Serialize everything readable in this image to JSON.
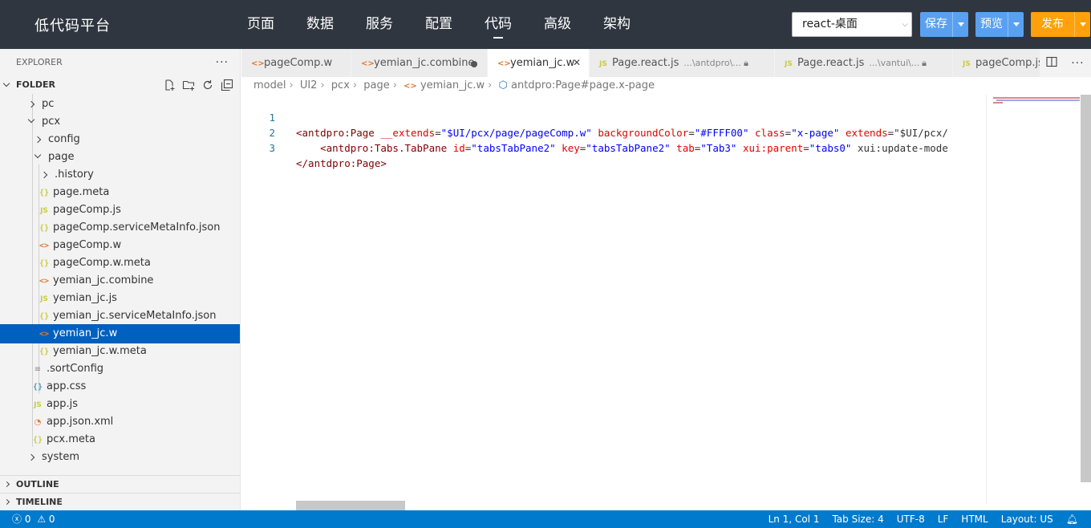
{
  "app": {
    "logo": "低代码平台"
  },
  "nav": [
    {
      "label": "页面"
    },
    {
      "label": "数据"
    },
    {
      "label": "服务"
    },
    {
      "label": "配置"
    },
    {
      "label": "代码"
    },
    {
      "label": "高级"
    },
    {
      "label": "架构"
    }
  ],
  "nav_active": "代码",
  "toolbar": {
    "project": "react-桌面",
    "save_label": "保存",
    "preview_label": "预览",
    "publish_label": "发布",
    "accent_blue": "#5aa0f0",
    "accent_orange": "#ffa10a"
  },
  "sidebar": {
    "explorer_title": "EXPLORER",
    "folder_title": "FOLDER",
    "tree": [
      {
        "label": "pc",
        "icon": "chevron-right-icon"
      },
      {
        "label": "pcx",
        "icon": "chevron-down-icon"
      },
      {
        "label": "config",
        "icon": "chevron-right-icon"
      },
      {
        "label": "page",
        "icon": "chevron-down-icon"
      },
      {
        "label": ".history",
        "icon": "chevron-right-icon"
      },
      {
        "label": "page.meta",
        "icon": "json-file-icon"
      },
      {
        "label": "pageComp.js",
        "icon": "js-file-icon"
      },
      {
        "label": "pageComp.serviceMetaInfo.json",
        "icon": "json-file-icon"
      },
      {
        "label": "pageComp.w",
        "icon": "xml-file-icon"
      },
      {
        "label": "pageComp.w.meta",
        "icon": "json-file-icon"
      },
      {
        "label": "yemian_jc.combine",
        "icon": "xml-file-icon"
      },
      {
        "label": "yemian_jc.js",
        "icon": "js-file-icon"
      },
      {
        "label": "yemian_jc.serviceMetaInfo.json",
        "icon": "json-file-icon"
      },
      {
        "label": "yemian_jc.w",
        "icon": "xml-file-icon"
      },
      {
        "label": "yemian_jc.w.meta",
        "icon": "json-file-icon"
      },
      {
        "label": ".sortConfig",
        "icon": "text-file-icon"
      },
      {
        "label": "app.css",
        "icon": "css-file-icon"
      },
      {
        "label": "app.js",
        "icon": "js-file-icon"
      },
      {
        "label": "app.json.xml",
        "icon": "rss-file-icon"
      },
      {
        "label": "pcx.meta",
        "icon": "json-file-icon"
      },
      {
        "label": "system",
        "icon": "chevron-right-icon"
      }
    ],
    "selected": "yemian_jc.w",
    "outline_label": "OUTLINE",
    "timeline_label": "TIMELINE"
  },
  "tabs": [
    {
      "label": "pageComp.w",
      "icon": "xml-file-icon"
    },
    {
      "label": "yemian_jc.combine",
      "icon": "xml-file-icon",
      "dirty": true
    },
    {
      "label": "yemian_jc.w",
      "icon": "xml-file-icon",
      "active": true
    },
    {
      "label": "Page.react.js",
      "desc": "...\\antdpro\\...",
      "icon": "js-file-icon",
      "locked": true
    },
    {
      "label": "Page.react.js",
      "desc": "...\\vantui\\...",
      "icon": "js-file-icon",
      "locked": true
    },
    {
      "label": "pageComp.js",
      "icon": "js-file-icon"
    }
  ],
  "breadcrumb": [
    "model",
    "UI2",
    "pcx",
    "page",
    "yemian_jc.w",
    "antdpro:Page#page.x-page"
  ],
  "code": [
    {
      "num": "1",
      "text": "<antdpro:Page __extends=\"$UI/pcx/page/pageComp.w\" backgroundColor=\"#FFFF00\" class=\"x-page\" extends=\"$UI/pcx/"
    },
    {
      "num": "2",
      "text": "    <antdpro:Tabs.TabPane id=\"tabsTabPane2\" key=\"tabsTabPane2\" tab=\"Tab3\" xui:parent=\"tabs0\" xui:update-mode"
    },
    {
      "num": "3",
      "text": "</antdpro:Page>"
    }
  ],
  "status": {
    "errors": "0",
    "warnings": "0",
    "position": "Ln 1, Col 1",
    "tab_size": "Tab Size: 4",
    "encoding": "UTF-8",
    "eol": "LF",
    "language": "HTML",
    "layout": "Layout: US"
  }
}
